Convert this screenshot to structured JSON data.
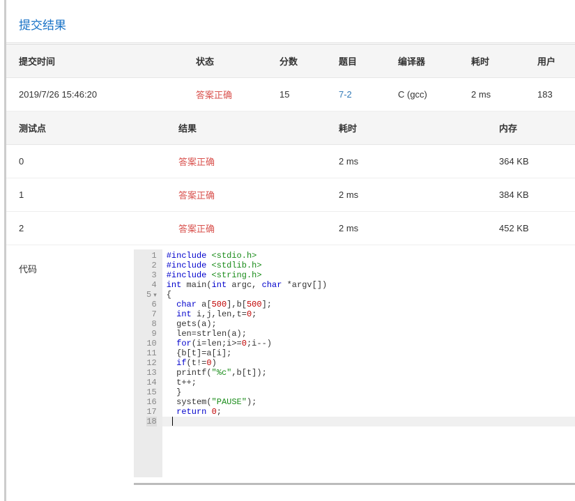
{
  "title": "提交结果",
  "mainTable": {
    "headers": {
      "time": "提交时间",
      "status": "状态",
      "score": "分数",
      "problem": "题目",
      "compiler": "编译器",
      "elapsed": "耗时",
      "user": "用户"
    },
    "row": {
      "time": "2019/7/26 15:46:20",
      "status": "答案正确",
      "score": "15",
      "problem": "7-2",
      "compiler": "C (gcc)",
      "elapsed": "2 ms",
      "user": "183"
    }
  },
  "testTable": {
    "headers": {
      "tp": "测试点",
      "result": "结果",
      "elapsed": "耗时",
      "memory": "内存"
    },
    "rows": [
      {
        "tp": "0",
        "result": "答案正确",
        "elapsed": "2 ms",
        "memory": "364 KB"
      },
      {
        "tp": "1",
        "result": "答案正确",
        "elapsed": "2 ms",
        "memory": "384 KB"
      },
      {
        "tp": "2",
        "result": "答案正确",
        "elapsed": "2 ms",
        "memory": "452 KB"
      }
    ]
  },
  "codeLabel": "代码",
  "code": {
    "lines": [
      {
        "n": "1",
        "html": "<span class='kw'>#include</span> <span class='inc'>&lt;stdio.h&gt;</span>"
      },
      {
        "n": "2",
        "html": "<span class='kw'>#include</span> <span class='inc'>&lt;stdlib.h&gt;</span>"
      },
      {
        "n": "3",
        "html": "<span class='kw'>#include</span> <span class='inc'>&lt;string.h&gt;</span>"
      },
      {
        "n": "4",
        "html": "<span class='ty'>int</span> main(<span class='ty'>int</span> argc, <span class='ty'>char</span> *argv[])"
      },
      {
        "n": "5",
        "fold": true,
        "html": "{"
      },
      {
        "n": "6",
        "html": "  <span class='ty'>char</span> a[<span class='num'>500</span>],b[<span class='num'>500</span>];"
      },
      {
        "n": "7",
        "html": "  <span class='ty'>int</span> i,j,len,t=<span class='num'>0</span>;"
      },
      {
        "n": "8",
        "html": "  gets(a);"
      },
      {
        "n": "9",
        "html": "  len=strlen(a);"
      },
      {
        "n": "10",
        "html": "  <span class='kw'>for</span>(i=len;i&gt;=<span class='num'>0</span>;i--)"
      },
      {
        "n": "11",
        "html": "  {b[t]=a[i];"
      },
      {
        "n": "12",
        "html": "  <span class='kw'>if</span>(t!=<span class='num'>0</span>)"
      },
      {
        "n": "13",
        "html": "  printf(<span class='str'>\"%c\"</span>,b[t]);"
      },
      {
        "n": "14",
        "html": "  t++;"
      },
      {
        "n": "15",
        "html": "  }"
      },
      {
        "n": "16",
        "html": "  system(<span class='str'>\"PAUSE\"</span>);"
      },
      {
        "n": "17",
        "html": "  <span class='kw'>return</span> <span class='num'>0</span>;"
      },
      {
        "n": "18",
        "active": true,
        "html": "}<span class='cursor'></span>"
      }
    ]
  }
}
